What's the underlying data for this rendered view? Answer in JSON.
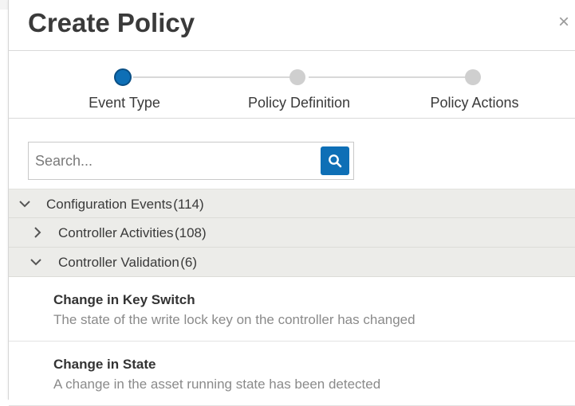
{
  "dialog": {
    "title": "Create Policy",
    "close_icon": "×"
  },
  "stepper": {
    "steps": [
      {
        "label": "Event Type",
        "state": "active"
      },
      {
        "label": "Policy Definition",
        "state": "pending"
      },
      {
        "label": "Policy Actions",
        "state": "pending"
      }
    ]
  },
  "search": {
    "placeholder": "Search...",
    "value": "",
    "button_icon": "search-icon"
  },
  "tree": {
    "group": {
      "label": "Configuration Events",
      "count": "(114)",
      "expanded": true
    },
    "subgroups": [
      {
        "label": "Controller Activities",
        "count": "(108)",
        "expanded": false
      },
      {
        "label": "Controller Validation",
        "count": "(6)",
        "expanded": true
      }
    ],
    "items": [
      {
        "name": "Change in Key Switch",
        "description": "The state of the write lock key on the controller has changed"
      },
      {
        "name": "Change in State",
        "description": "A change in the asset running state has been detected"
      }
    ]
  },
  "colors": {
    "accent": "#0e6fb6",
    "row_bg": "#ecece9",
    "muted_text": "#8a8a8a"
  }
}
